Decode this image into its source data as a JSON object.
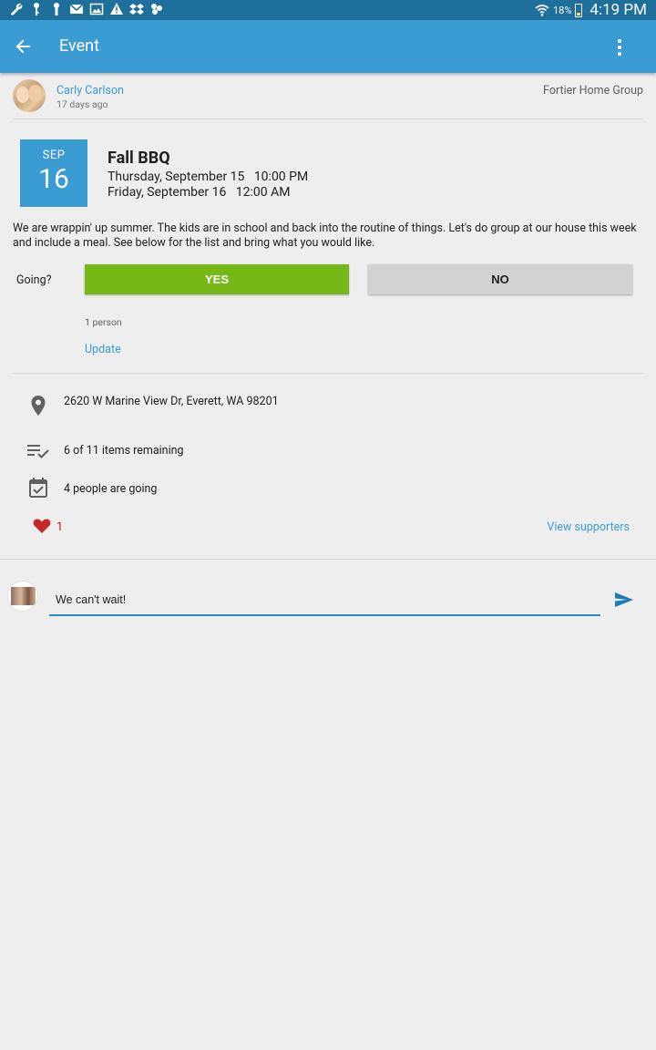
{
  "status_bar": {
    "battery": "18%",
    "time": "4:19 PM",
    "icons": [
      "wrench-icon",
      "key-icon",
      "key-icon",
      "gmail-icon",
      "image-icon",
      "warning-icon",
      "dropbox-icon",
      "puzzle-icon",
      "wifi-icon",
      "battery-icon"
    ]
  },
  "appbar": {
    "title": "Event"
  },
  "author": {
    "name": "Carly Carlson",
    "time": "17 days ago",
    "group": "Fortier Home Group"
  },
  "event": {
    "month": "SEP",
    "day": "16",
    "title": "Fall BBQ",
    "start": "Thursday, September 15   10:00 PM",
    "end": "Friday, September 16   12:00 AM",
    "description": "We are wrappin' up summer. The kids are in school and back into the routine of things. Let's do group at our house this week and include a meal. See below for the list and bring what you would like."
  },
  "rsvp": {
    "label": "Going?",
    "yes": "YES",
    "no": "NO",
    "count": "1 person",
    "update": "Update"
  },
  "details": {
    "address": "2620 W Marine View Dr, Everett, WA  98201",
    "items": "6 of 11 items remaining",
    "going": "4 people are going",
    "likes": "1",
    "view_supporters": "View supporters"
  },
  "comment": {
    "value": "We can't wait!"
  },
  "colors": {
    "status_bar": "#1e6f9b",
    "app_bar": "#3b9bd3",
    "accent": "#3b9bd3",
    "yes_button": "#76b817",
    "no_button": "#d2d2d2",
    "heart": "#c62828",
    "background": "#eeeeee"
  }
}
